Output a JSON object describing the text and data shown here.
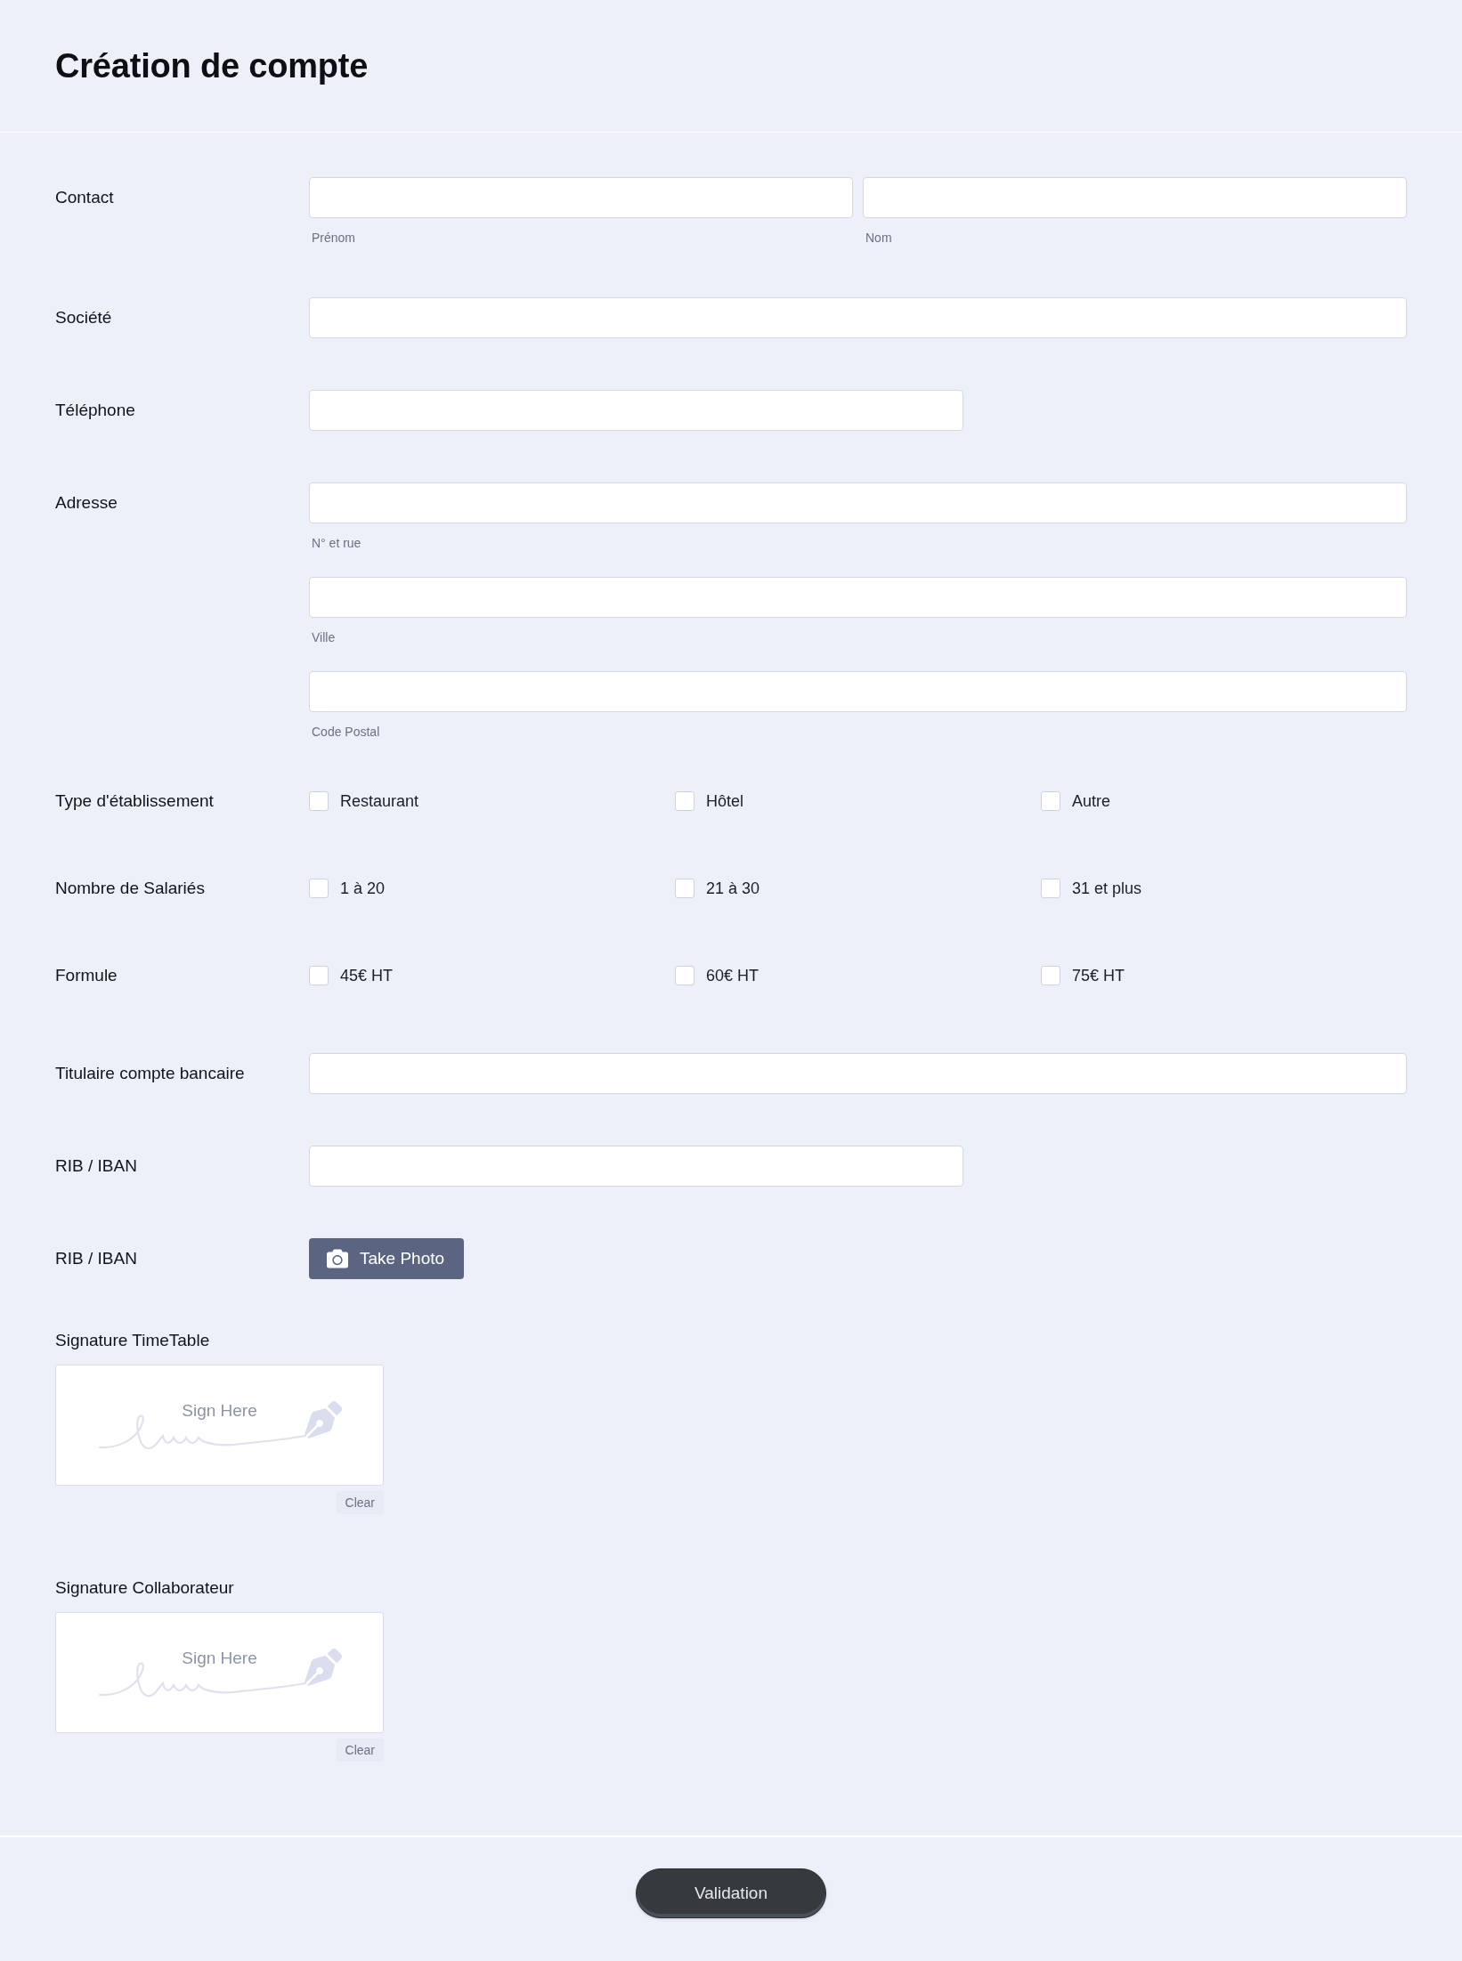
{
  "form": {
    "title": "Création de compte"
  },
  "fields": [
    {
      "kind": "name_pair",
      "label": "Contact",
      "inputs": [
        {
          "sublabel": "Prénom"
        },
        {
          "sublabel": "Nom"
        }
      ]
    },
    {
      "kind": "text",
      "label": "Société"
    },
    {
      "kind": "short_text",
      "label": "Téléphone"
    },
    {
      "kind": "stacked",
      "label": "Adresse",
      "inputs": [
        {
          "sublabel": "N° et rue"
        },
        {
          "sublabel": "Ville"
        },
        {
          "sublabel": "Code Postal"
        }
      ]
    },
    {
      "kind": "checkboxes",
      "label": "Type d'établissement",
      "options": [
        {
          "label": "Restaurant",
          "checked": false
        },
        {
          "label": "Hôtel",
          "checked": false
        },
        {
          "label": "Autre",
          "checked": false
        }
      ]
    },
    {
      "kind": "checkboxes",
      "label": "Nombre de Salariés",
      "options": [
        {
          "label": "1 à 20",
          "checked": false
        },
        {
          "label": "21 à 30",
          "checked": false
        },
        {
          "label": "31 et plus",
          "checked": false
        }
      ]
    },
    {
      "kind": "checkboxes",
      "label": "Formule",
      "options": [
        {
          "label": "45€ HT",
          "checked": false
        },
        {
          "label": "60€ HT",
          "checked": false
        },
        {
          "label": "75€ HT",
          "checked": false
        }
      ]
    },
    {
      "kind": "text",
      "label": "Titulaire compte bancaire"
    },
    {
      "kind": "short_text",
      "label": "RIB / IBAN"
    },
    {
      "kind": "photo",
      "label": "RIB / IBAN",
      "button": "Take Photo"
    }
  ],
  "signatures": [
    {
      "label": "Signature TimeTable",
      "prompt": "Sign Here",
      "clear": "Clear"
    },
    {
      "label": "Signature Collaborateur",
      "prompt": "Sign Here",
      "clear": "Clear"
    }
  ],
  "submit": {
    "label": "Validation"
  }
}
